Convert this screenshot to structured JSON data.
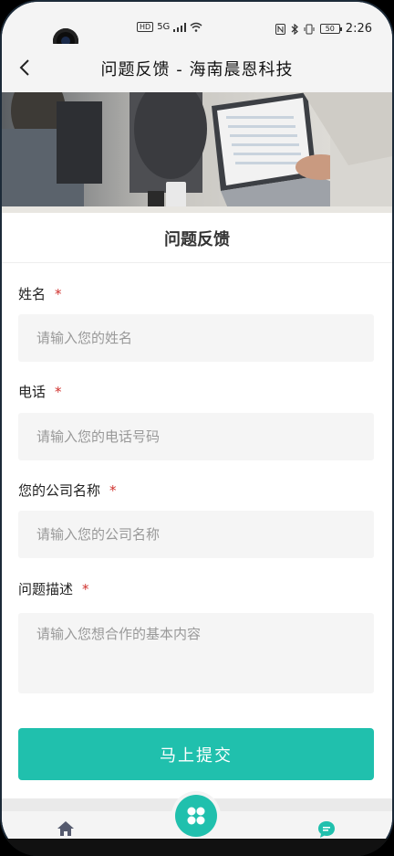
{
  "status_bar": {
    "network_badge": "HD",
    "signal_label": "5G",
    "battery_level": "50",
    "time": "2:26"
  },
  "header": {
    "title": "问题反馈 - 海南晨恩科技"
  },
  "form": {
    "heading": "问题反馈",
    "required_mark": "*",
    "fields": [
      {
        "label": "姓名",
        "placeholder": "请输入您的姓名"
      },
      {
        "label": "电话",
        "placeholder": "请输入您的电话号码"
      },
      {
        "label": "您的公司名称",
        "placeholder": "请输入您的公司名称"
      },
      {
        "label": "问题描述",
        "placeholder": "请输入您想合作的基本内容"
      }
    ],
    "submit_label": "马上提交"
  },
  "colors": {
    "accent": "#20c0ad",
    "required": "#d0312d",
    "nav_icon": "#555a6e"
  },
  "bottom_nav": {
    "items": [
      "home-icon",
      "apps-icon",
      "chat-icon"
    ]
  }
}
